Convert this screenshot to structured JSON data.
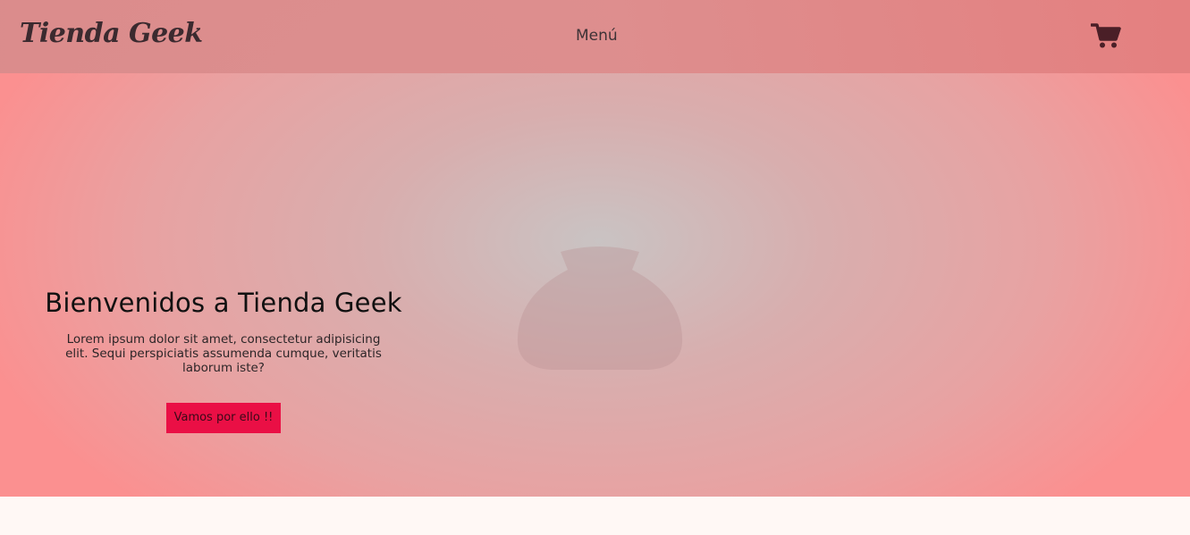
{
  "header": {
    "logo": "Tienda Geek",
    "menu_label": "Menú",
    "cart_icon": "shopping-cart-icon"
  },
  "hero": {
    "title": "Bienvenidos a Tienda Geek",
    "description": "Lorem ipsum dolor sit amet, consectetur adipisicing elit. Sequi perspiciatis assumenda cumque, veritatis laborum iste?",
    "cta_label": "Vamos por ello !!"
  },
  "colors": {
    "cta_background": "#ea0f45",
    "header_background": "#dd8d8d",
    "cart_icon": "#4a1f27"
  }
}
